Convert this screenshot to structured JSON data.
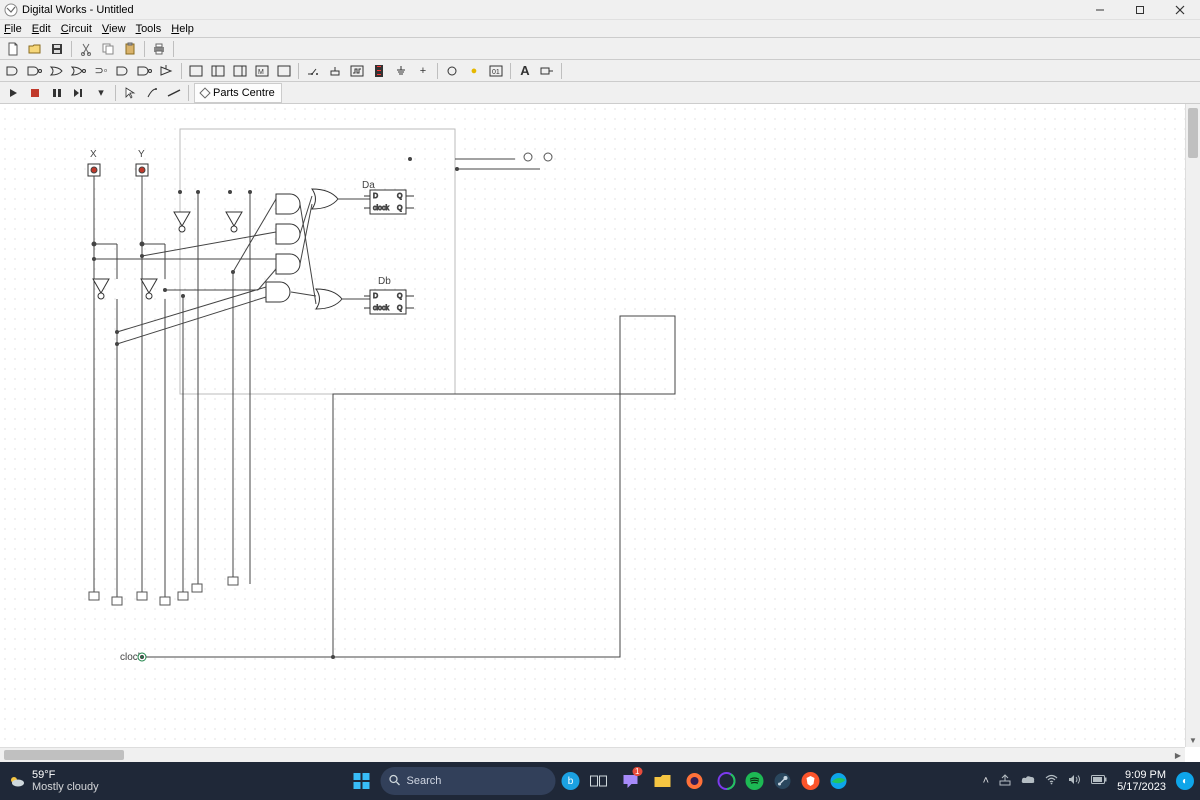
{
  "title": "Digital Works - Untitled",
  "menus": [
    "File",
    "Edit",
    "Circuit",
    "View",
    "Tools",
    "Help"
  ],
  "parts_centre_label": "Parts Centre",
  "circuit": {
    "labels": {
      "X": "X",
      "Y": "Y",
      "Da": "Da",
      "Db": "Db",
      "clock": "clock"
    },
    "ff_pins": {
      "d": "D",
      "q": "Q",
      "clk": "clock",
      "qbar": "Q"
    }
  },
  "taskbar": {
    "weather_temp": "59°F",
    "weather_cond": "Mostly cloudy",
    "search_placeholder": "Search",
    "time": "9:09 PM",
    "date": "5/17/2023"
  }
}
